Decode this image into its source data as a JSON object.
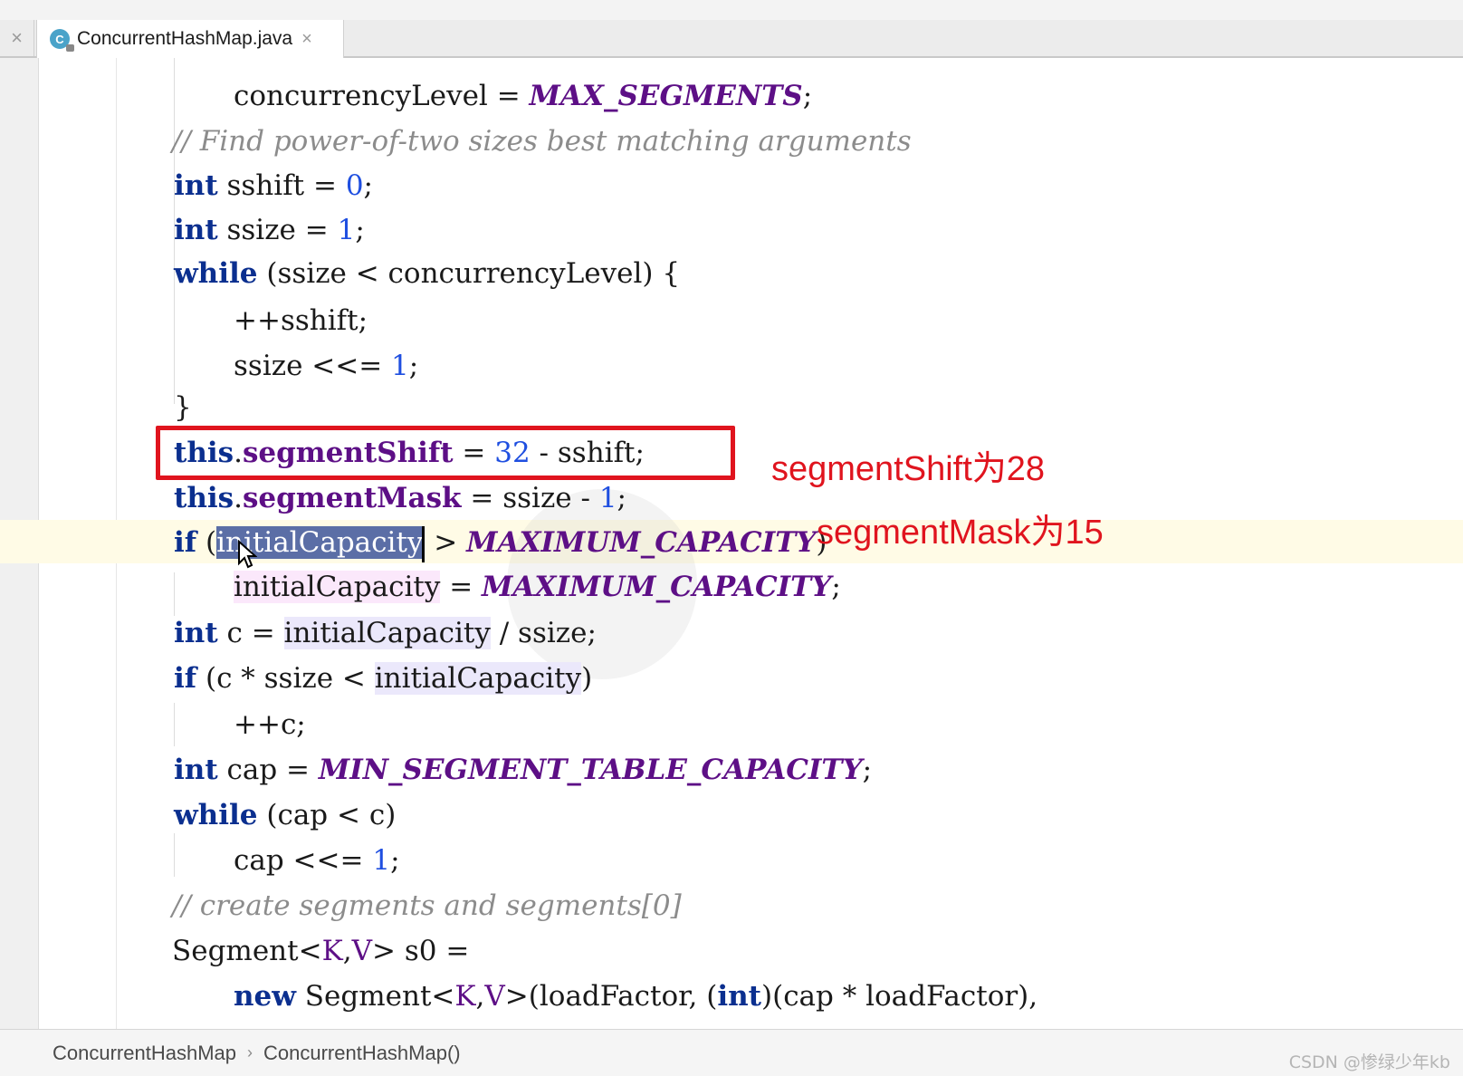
{
  "tab": {
    "icon_letter": "C",
    "filename": "ConcurrentHashMap.java",
    "close_glyph": "×",
    "bar_close_glyph": "×"
  },
  "code": {
    "l1": {
      "a": "concurrencyLevel = ",
      "b": "MAX_SEGMENTS",
      "c": ";"
    },
    "l2": {
      "a": "// Find power-of-two sizes best matching arguments"
    },
    "l3": {
      "kw": "int",
      "a": " sshift = ",
      "n": "0",
      "c": ";"
    },
    "l4": {
      "kw": "int",
      "a": " ssize = ",
      "n": "1",
      "c": ";"
    },
    "l5": {
      "kw": "while",
      "a": " (ssize < concurrencyLevel) {"
    },
    "l6": {
      "a": "++sshift;"
    },
    "l7": {
      "a": "ssize <<= ",
      "n": "1",
      "c": ";"
    },
    "l8": {
      "a": "}"
    },
    "l9": {
      "kw": "this",
      "dot": ".",
      "f": "segmentShift",
      "a": " = ",
      "n": "32",
      "b": " - sshift;"
    },
    "l10": {
      "kw": "this",
      "dot": ".",
      "f": "segmentMask",
      "a": " = ssize - ",
      "n": "1",
      "c": ";"
    },
    "l11": {
      "kw": "if",
      "a": " (",
      "sel": "initialCapacity",
      "b": " > ",
      "cst": "MAXIMUM_CAPACITY",
      "c": ")"
    },
    "l12": {
      "hl": "initialCapacity",
      "a": " = ",
      "cst": "MAXIMUM_CAPACITY",
      "c": ";"
    },
    "l13": {
      "kw": "int",
      "a": " c = ",
      "hl": "initialCapacity",
      "b": " / ssize;"
    },
    "l14": {
      "kw": "if",
      "a": " (c * ssize < ",
      "hl": "initialCapacity",
      "c": ")"
    },
    "l15": {
      "a": "++c;"
    },
    "l16": {
      "kw": "int",
      "a": " cap = ",
      "cst": "MIN_SEGMENT_TABLE_CAPACITY",
      "c": ";"
    },
    "l17": {
      "kw": "while",
      "a": " (cap < c)"
    },
    "l18": {
      "a": "cap <<= ",
      "n": "1",
      "c": ";"
    },
    "l19": {
      "a": "// create segments and segments[0]"
    },
    "l20": {
      "a": "Segment<",
      "t1": "K",
      "comma": ",",
      "t2": "V",
      "b": "> s0 ="
    },
    "l21": {
      "kw": "new",
      "a": " Segment<",
      "t1": "K",
      "comma": ",",
      "t2": "V",
      "b": ">(loadFactor, (",
      "kw2": "int",
      "c": ")(cap * loadFactor),"
    }
  },
  "annotations": {
    "shift": "segmentShift为28",
    "mask": "segmentMask为15"
  },
  "breadcrumb": {
    "item1": "ConcurrentHashMap",
    "sep": "›",
    "item2": "ConcurrentHashMap()"
  },
  "watermark": "CSDN @惨绿少年kb",
  "colors": {
    "keyword": "#0b2f8f",
    "number": "#1f4fe0",
    "constant": "#5d0f86",
    "comment": "#8c8c8c",
    "annotation": "#e0141e",
    "selection": "#5b6ea6"
  }
}
